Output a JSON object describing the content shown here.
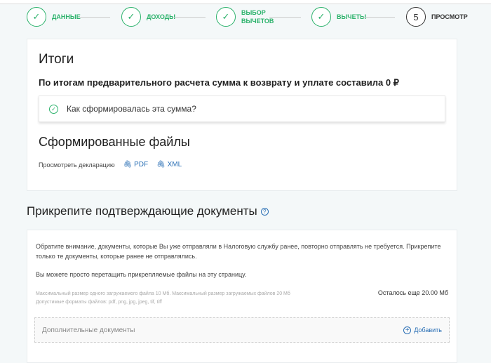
{
  "steps": [
    {
      "label": "ДАННЫЕ",
      "done": true
    },
    {
      "label": "ДОХОДЫ",
      "done": true
    },
    {
      "label": "ВЫБОР ВЫЧЕТОВ",
      "done": true
    },
    {
      "label": "ВЫЧЕТЫ",
      "done": true
    },
    {
      "label": "ПРОСМОТР",
      "number": "5",
      "done": false
    }
  ],
  "summary": {
    "title": "Итоги",
    "text": "По итогам предварительного расчета сумма к возврату и уплате составила 0 ₽",
    "accordion": "Как сформировалась эта сумма?"
  },
  "files": {
    "title": "Сформированные файлы",
    "view_label": "Просмотреть декларацию",
    "pdf": "PDF",
    "xml": "XML"
  },
  "attach": {
    "title": "Прикрепите подтверждающие документы",
    "help": "?",
    "notice": "Обратите внимание, документы, которые Вы уже отправляли в Налоговую службу ранее, повторно отправлять не требуется. Прикрепите только те документы, которые ранее не отправлялись.",
    "drag": "Вы можете просто перетащить прикрепляемые файлы на эту страницу.",
    "limits": "Максимальный размер одного загружаемого файла 10 Мб. Максимальный размер загружаемых файлов 20 Мб",
    "formats": "Допустимые форматы файлов: pdf, png, jpg, jpeg, tif, tiff",
    "remaining": "Осталось еще 20.00 Мб",
    "section": "Дополнительные документы",
    "add": "Добавить"
  }
}
